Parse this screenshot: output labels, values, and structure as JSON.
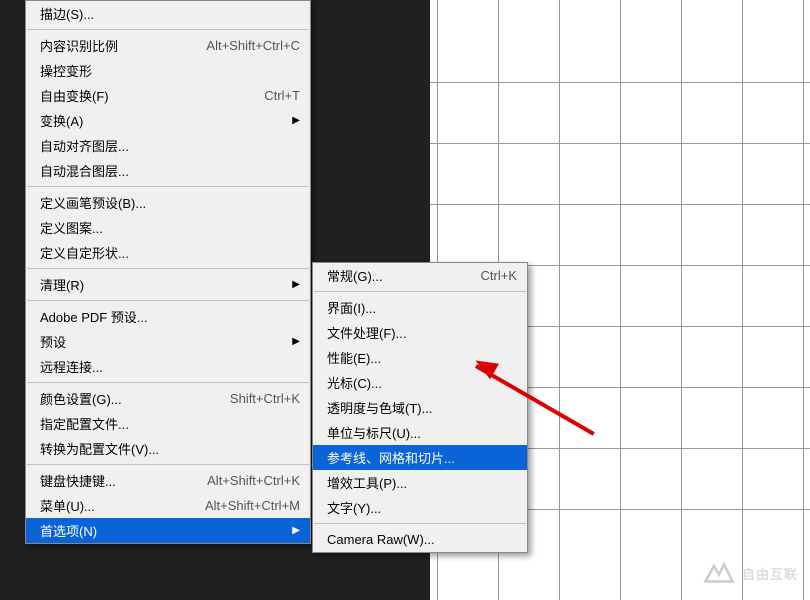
{
  "menu1": {
    "stroke": "描边(S)...",
    "content_aware_scale": "内容识别比例",
    "content_aware_scale_sc": "Alt+Shift+Ctrl+C",
    "puppet_warp": "操控变形",
    "free_transform": "自由变换(F)",
    "free_transform_sc": "Ctrl+T",
    "transform": "变换(A)",
    "auto_align": "自动对齐图层...",
    "auto_blend": "自动混合图层...",
    "define_brush": "定义画笔预设(B)...",
    "define_pattern": "定义图案...",
    "define_shape": "定义自定形状...",
    "purge": "清理(R)",
    "pdf_presets": "Adobe PDF 预设...",
    "presets": "预设",
    "remote_conn": "远程连接...",
    "color_settings": "颜色设置(G)...",
    "color_settings_sc": "Shift+Ctrl+K",
    "assign_profile": "指定配置文件...",
    "convert_profile": "转换为配置文件(V)...",
    "keyboard_shortcuts": "键盘快捷键...",
    "keyboard_shortcuts_sc": "Alt+Shift+Ctrl+K",
    "menus": "菜单(U)...",
    "menus_sc": "Alt+Shift+Ctrl+M",
    "preferences": "首选项(N)"
  },
  "menu2": {
    "general": "常规(G)...",
    "general_sc": "Ctrl+K",
    "interface": "界面(I)...",
    "file_handling": "文件处理(F)...",
    "performance": "性能(E)...",
    "cursors": "光标(C)...",
    "transparency": "透明度与色域(T)...",
    "units": "单位与标尺(U)...",
    "guides": "参考线、网格和切片...",
    "plugins": "增效工具(P)...",
    "type": "文字(Y)...",
    "camera_raw": "Camera Raw(W)..."
  },
  "watermark": "自由互联"
}
